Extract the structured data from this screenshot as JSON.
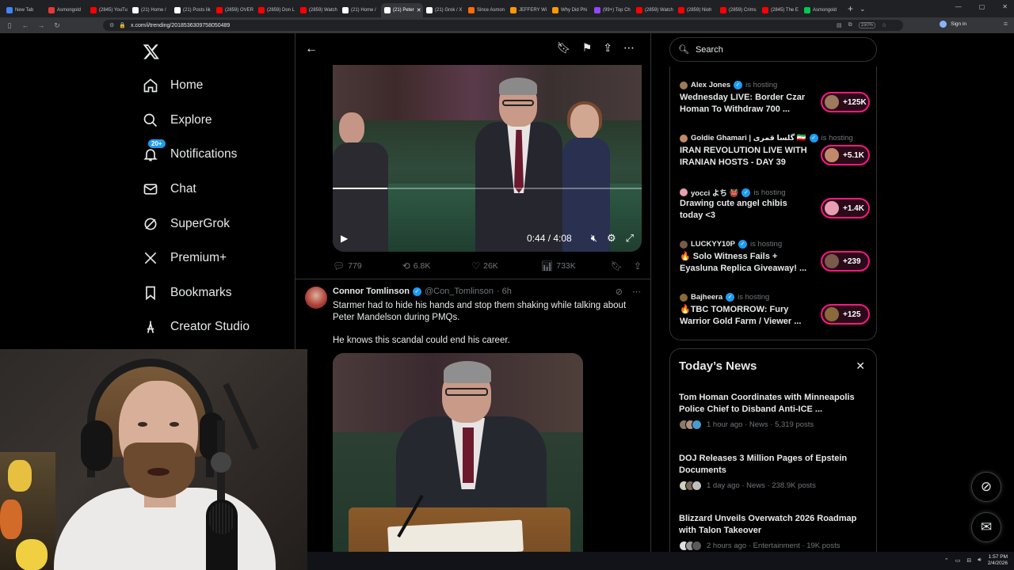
{
  "browser": {
    "tabs": [
      {
        "label": "New Tab",
        "color": "#4285f4"
      },
      {
        "label": "Asmongold",
        "color": "#e53935"
      },
      {
        "label": "(2845) YouTu",
        "color": "#ff0000"
      },
      {
        "label": "(21) Home /",
        "color": "#ffffff"
      },
      {
        "label": "(21) Posts lik",
        "color": "#ffffff"
      },
      {
        "label": "(2859) OVER",
        "color": "#ff0000"
      },
      {
        "label": "(2859) Don L",
        "color": "#ff0000"
      },
      {
        "label": "(2859) Watch",
        "color": "#ff0000"
      },
      {
        "label": "(21) Home /",
        "color": "#ffffff"
      },
      {
        "label": "(21) Peter",
        "color": "#ffffff",
        "active": true
      },
      {
        "label": "(21) Grok / X",
        "color": "#ffffff"
      },
      {
        "label": "Since Asmon",
        "color": "#ff6d00"
      },
      {
        "label": "JEFFERY Wi",
        "color": "#ff9800"
      },
      {
        "label": "Why Did Phi",
        "color": "#ff9800"
      },
      {
        "label": "(99+) Top Ch",
        "color": "#9146ff"
      },
      {
        "label": "(2859) Watch",
        "color": "#ff0000"
      },
      {
        "label": "(2859) Nioh",
        "color": "#ff0000"
      },
      {
        "label": "(2859) Crims",
        "color": "#ff0000"
      },
      {
        "label": "(2845) The E",
        "color": "#ff0000"
      },
      {
        "label": "Asmongold",
        "color": "#00c853"
      }
    ],
    "url": "x.com/i/trending/2018536309758050489",
    "zoom": "150%",
    "profile_label": "Sign in"
  },
  "nav": {
    "items": [
      {
        "label": "Home",
        "icon": "home-icon"
      },
      {
        "label": "Explore",
        "icon": "search-icon"
      },
      {
        "label": "Notifications",
        "icon": "bell-icon",
        "badge": "20+"
      },
      {
        "label": "Chat",
        "icon": "mail-icon"
      },
      {
        "label": "SuperGrok",
        "icon": "grok-icon"
      },
      {
        "label": "Premium+",
        "icon": "x-icon"
      },
      {
        "label": "Bookmarks",
        "icon": "bookmark-icon"
      },
      {
        "label": "Creator Studio",
        "icon": "creator-icon"
      }
    ]
  },
  "video": {
    "time": "0:44 / 4:08",
    "progress": 0.178
  },
  "post1_stats": {
    "replies": "779",
    "reposts": "6.8K",
    "likes": "26K",
    "views": "733K"
  },
  "post2": {
    "name": "Connor Tomlinson",
    "handle": "@Con_Tomlinson",
    "time": "· 6h",
    "text": "Starmer had to hide his hands and stop them shaking while talking about Peter Mandelson during PMQs.",
    "text2": "He knows this scandal could end his career."
  },
  "search": {
    "placeholder": "Search"
  },
  "spaces": [
    {
      "host": "Alex Jones",
      "status": "is hosting",
      "title": "Wednesday LIVE: Border Czar Homan To Withdraw 700 ...",
      "count": "+125K",
      "color": "#9c7a5a"
    },
    {
      "host": "Goldie Ghamari | گلسا قمری 🇮🇷",
      "status": "is hosting",
      "title": "IRAN REVOLUTION LIVE WITH IRANIAN HOSTS - DAY 39",
      "count": "+5.1K",
      "color": "#c08a6a"
    },
    {
      "host": "yocci よち 👹",
      "status": "is hosting",
      "title": "Drawing cute angel chibis today <3",
      "count": "+1.4K",
      "color": "#e8a0b0"
    },
    {
      "host": "LUCKYY10P",
      "status": "is hosting",
      "title": "🔥 Solo Witness Fails + Eyasluna Replica Giveaway! ...",
      "count": "+239",
      "color": "#7a5a4a"
    },
    {
      "host": "Bajheera",
      "status": "is hosting",
      "title": "🔥TBC TOMORROW: Fury Warrior Gold Farm / Viewer ...",
      "count": "+125",
      "color": "#8a6a3a"
    }
  ],
  "news": {
    "title": "Today’s News",
    "items": [
      {
        "headline": "Tom Homan Coordinates with Minneapolis Police Chief to Disband Anti-ICE ...",
        "meta": "1 hour ago · News · 5,319 posts"
      },
      {
        "headline": "DOJ Releases 3 Million Pages of Epstein Documents",
        "meta": "1 day ago · News · 238.9K posts"
      },
      {
        "headline": "Blizzard Unveils Overwatch 2026 Roadmap with Talon Takeover",
        "meta": "2 hours ago · Entertainment · 19K posts"
      }
    ]
  },
  "taskbar": {
    "time": "1:57 PM",
    "date": "2/4/2026"
  }
}
